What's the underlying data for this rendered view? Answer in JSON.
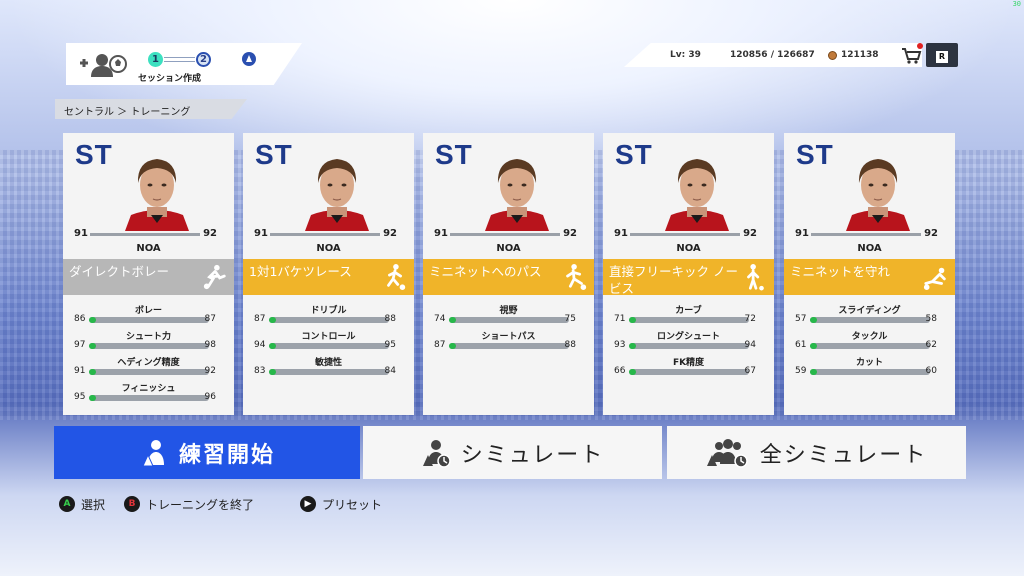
{
  "fps": "30",
  "session": {
    "step1": "1",
    "step2": "2",
    "label": "セッション作成"
  },
  "header": {
    "level": "Lv: 39",
    "xp": "120856 / 126687",
    "coins": "121138",
    "r_button": "R"
  },
  "breadcrumb": "セントラル ＞ トレーニング",
  "colors": {
    "primary": "#2255e6",
    "gold": "#f0b429",
    "gray": "#b7b7b7",
    "bar_fill": "#27b84a",
    "position": "#1e3a8a"
  },
  "cards": [
    {
      "position": "ST",
      "ovr_before": "91",
      "ovr_after": "92",
      "name": "NOA",
      "drill": "ダイレクトボレー",
      "drill_style": "gray",
      "drill_icon": "volley-icon",
      "attrs": [
        {
          "label": "ボレー",
          "before": "86",
          "after": "87"
        },
        {
          "label": "シュート力",
          "before": "97",
          "after": "98"
        },
        {
          "label": "ヘディング精度",
          "before": "91",
          "after": "92"
        },
        {
          "label": "フィニッシュ",
          "before": "95",
          "after": "96"
        }
      ]
    },
    {
      "position": "ST",
      "ovr_before": "91",
      "ovr_after": "92",
      "name": "NOA",
      "drill": "1対1バケツレース",
      "drill_style": "gold",
      "drill_icon": "dribble-icon",
      "attrs": [
        {
          "label": "ドリブル",
          "before": "87",
          "after": "88"
        },
        {
          "label": "コントロール",
          "before": "94",
          "after": "95"
        },
        {
          "label": "敏捷性",
          "before": "83",
          "after": "84"
        }
      ]
    },
    {
      "position": "ST",
      "ovr_before": "91",
      "ovr_after": "92",
      "name": "NOA",
      "drill": "ミニネットへのパス",
      "drill_style": "gold",
      "drill_icon": "pass-icon",
      "attrs": [
        {
          "label": "視野",
          "before": "74",
          "after": "75"
        },
        {
          "label": "ショートパス",
          "before": "87",
          "after": "88"
        }
      ]
    },
    {
      "position": "ST",
      "ovr_before": "91",
      "ovr_after": "92",
      "name": "NOA",
      "drill": "直接フリーキック ノービス",
      "drill_style": "gold",
      "drill_icon": "free-kick-icon",
      "attrs": [
        {
          "label": "カーブ",
          "before": "71",
          "after": "72"
        },
        {
          "label": "ロングシュート",
          "before": "93",
          "after": "94"
        },
        {
          "label": "FK精度",
          "before": "66",
          "after": "67"
        }
      ]
    },
    {
      "position": "ST",
      "ovr_before": "91",
      "ovr_after": "92",
      "name": "NOA",
      "drill": "ミニネットを守れ",
      "drill_style": "gold",
      "drill_icon": "tackle-icon",
      "attrs": [
        {
          "label": "スライディング",
          "before": "57",
          "after": "58"
        },
        {
          "label": "タックル",
          "before": "61",
          "after": "62"
        },
        {
          "label": "カット",
          "before": "59",
          "after": "60"
        }
      ]
    }
  ],
  "buttons": {
    "start": "練習開始",
    "simulate": "シミュレート",
    "simulate_all": "全シミュレート"
  },
  "footer": {
    "select_key": "A",
    "select": "選択",
    "end_key": "B",
    "end": "トレーニングを終了",
    "preset_key": "▶",
    "preset": "プリセット"
  }
}
